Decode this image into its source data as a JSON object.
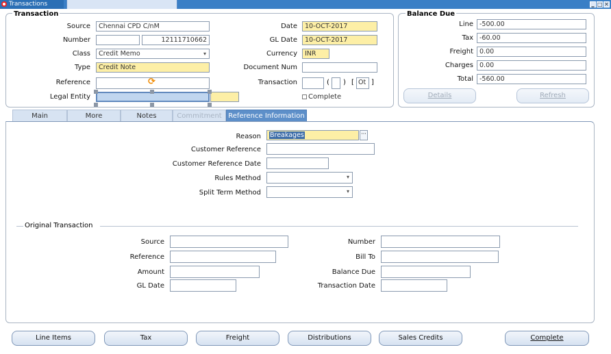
{
  "window": {
    "title": "Transactions"
  },
  "transaction": {
    "group_title": "Transaction",
    "source": {
      "label": "Source",
      "value": "Chennai CPD C/nM"
    },
    "number": {
      "label": "Number",
      "value": "12111710662"
    },
    "class": {
      "label": "Class",
      "value": "Credit Memo"
    },
    "type": {
      "label": "Type",
      "value": "Credit Note"
    },
    "reference": {
      "label": "Reference",
      "value": ""
    },
    "legal_entity": {
      "label": "Legal Entity",
      "value": ""
    },
    "date": {
      "label": "Date",
      "value": "10-OCT-2017"
    },
    "gl_date": {
      "label": "GL Date",
      "value": "10-OCT-2017"
    },
    "currency": {
      "label": "Currency",
      "value": "INR"
    },
    "document_num": {
      "label": "Document Num",
      "value": ""
    },
    "transaction_field": {
      "label": "Transaction",
      "paren_open": "(",
      "paren_close": ")",
      "bracket_open": "[",
      "bracket_value": "Ot",
      "bracket_close": "]"
    },
    "complete_label": "Complete"
  },
  "balance_due": {
    "group_title": "Balance Due",
    "line": {
      "label": "Line",
      "value": "-500.00"
    },
    "tax": {
      "label": "Tax",
      "value": "-60.00"
    },
    "freight": {
      "label": "Freight",
      "value": "0.00"
    },
    "charges": {
      "label": "Charges",
      "value": "0.00"
    },
    "total": {
      "label": "Total",
      "value": "-560.00"
    },
    "details_button": "Details",
    "refresh_button": "Refresh"
  },
  "tabs": [
    {
      "label": "Main",
      "state": "normal"
    },
    {
      "label": "More",
      "state": "normal"
    },
    {
      "label": "Notes",
      "state": "normal"
    },
    {
      "label": "Commitment",
      "state": "disabled"
    },
    {
      "label": "Reference Information",
      "state": "active"
    }
  ],
  "reference_info": {
    "reason": {
      "label": "Reason",
      "value": "Breakages"
    },
    "customer_reference": {
      "label": "Customer Reference",
      "value": ""
    },
    "customer_reference_date": {
      "label": "Customer Reference Date",
      "value": ""
    },
    "rules_method": {
      "label": "Rules Method",
      "value": ""
    },
    "split_term_method": {
      "label": "Split Term Method",
      "value": ""
    }
  },
  "original_transaction": {
    "group_title": "Original Transaction",
    "source": {
      "label": "Source",
      "value": ""
    },
    "reference": {
      "label": "Reference",
      "value": ""
    },
    "amount": {
      "label": "Amount",
      "value": ""
    },
    "gl_date": {
      "label": "GL Date",
      "value": ""
    },
    "number": {
      "label": "Number",
      "value": ""
    },
    "bill_to": {
      "label": "Bill To",
      "value": ""
    },
    "balance_due": {
      "label": "Balance Due",
      "value": ""
    },
    "transaction_date": {
      "label": "Transaction Date",
      "value": ""
    }
  },
  "bottom_buttons": {
    "line_items": "Line Items",
    "tax": "Tax",
    "freight": "Freight",
    "distributions": "Distributions",
    "sales_credits": "Sales Credits",
    "complete": "Complete"
  },
  "colors": {
    "title_bar": "#3a7fc6",
    "required_field": "#fdefa6",
    "active_tab": "#5d8fc9"
  },
  "icons": [
    "oracle-app-icon",
    "minimize-icon",
    "maximize-icon",
    "close-icon",
    "list-of-values-icon",
    "refresh-arrow-icon",
    "dropdown-arrow-icon"
  ]
}
